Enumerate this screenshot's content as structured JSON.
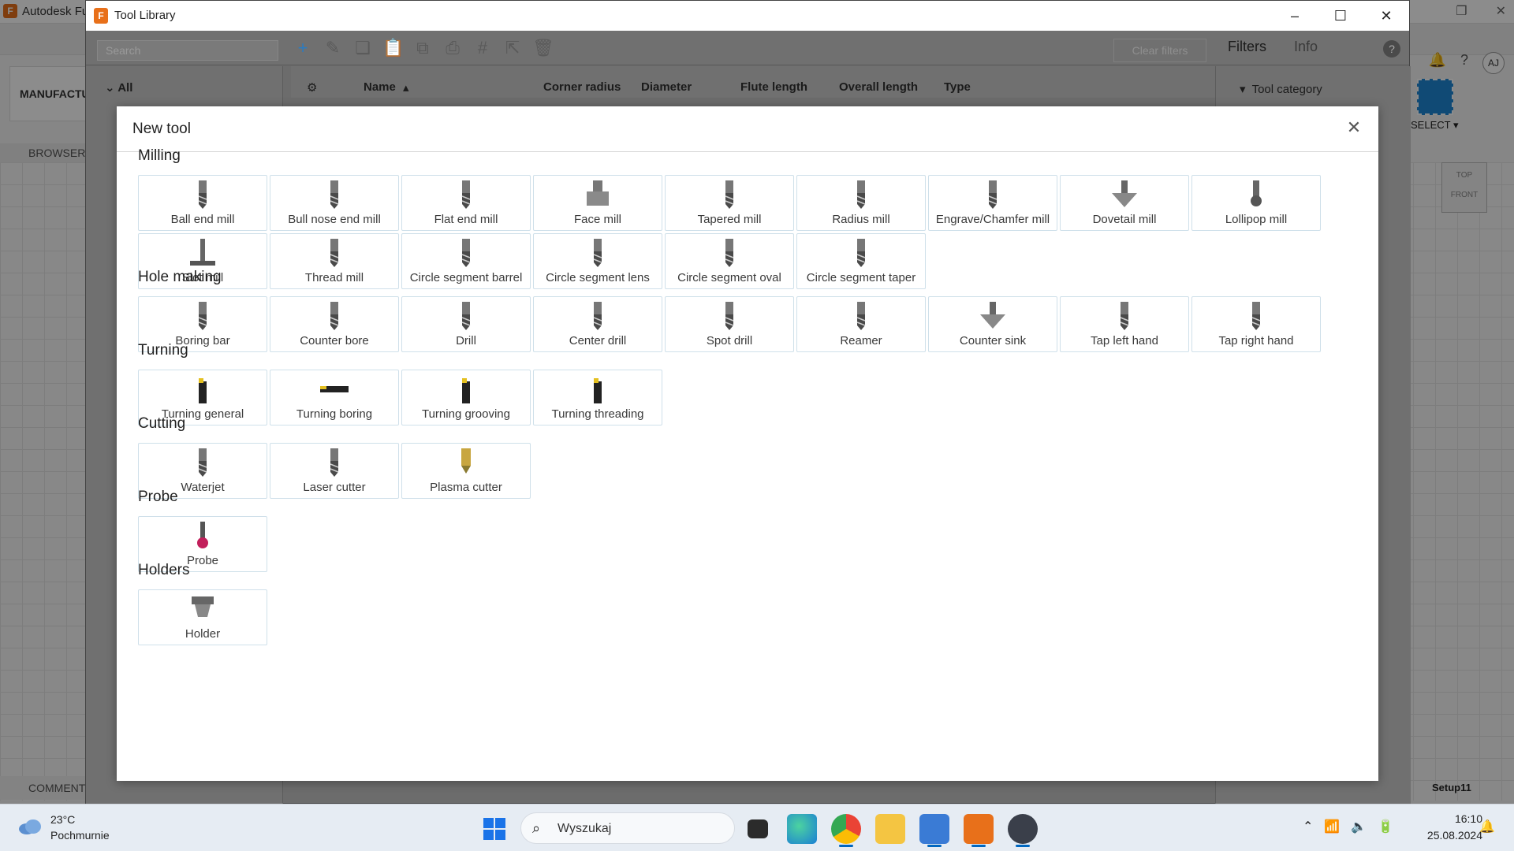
{
  "background_app": {
    "title": "Autodesk Fu",
    "manufacture": "MANUFACTU",
    "browser": "BROWSER",
    "comments": "COMMENT",
    "select_label": "SELECT ▾",
    "setup": "Setup11",
    "avatar": "AJ",
    "viewcube_top": "TOP",
    "viewcube_front": "FRONT"
  },
  "tool_library": {
    "title": "Tool Library",
    "search_placeholder": "Search",
    "clear_filters": "Clear filters",
    "tabs": {
      "filters": "Filters",
      "info": "Info"
    },
    "tree_all": "All",
    "columns": [
      "Name",
      "Corner radius",
      "Diameter",
      "Flute length",
      "Overall length",
      "Type"
    ],
    "tool_category": "Tool category"
  },
  "dialog": {
    "title": "New tool",
    "sections": [
      {
        "title": "Milling",
        "tools": [
          {
            "label": "Ball end mill",
            "icon": "ball-end-mill-icon"
          },
          {
            "label": "Bull nose end mill",
            "icon": "bull-nose-end-mill-icon"
          },
          {
            "label": "Flat end mill",
            "icon": "flat-end-mill-icon"
          },
          {
            "label": "Face mill",
            "icon": "face-mill-icon"
          },
          {
            "label": "Tapered mill",
            "icon": "tapered-mill-icon"
          },
          {
            "label": "Radius mill",
            "icon": "radius-mill-icon"
          },
          {
            "label": "Engrave/Chamfer mill",
            "icon": "engrave-chamfer-mill-icon"
          },
          {
            "label": "Dovetail mill",
            "icon": "dovetail-mill-icon"
          },
          {
            "label": "Lollipop mill",
            "icon": "lollipop-mill-icon"
          },
          {
            "label": "Slot mill",
            "icon": "slot-mill-icon"
          },
          {
            "label": "Thread mill",
            "icon": "thread-mill-icon"
          },
          {
            "label": "Circle segment barrel",
            "icon": "circle-segment-barrel-icon"
          },
          {
            "label": "Circle segment lens",
            "icon": "circle-segment-lens-icon"
          },
          {
            "label": "Circle segment oval",
            "icon": "circle-segment-oval-icon"
          },
          {
            "label": "Circle segment taper",
            "icon": "circle-segment-taper-icon"
          }
        ]
      },
      {
        "title": "Hole making",
        "tools": [
          {
            "label": "Boring bar",
            "icon": "boring-bar-icon"
          },
          {
            "label": "Counter bore",
            "icon": "counter-bore-icon"
          },
          {
            "label": "Drill",
            "icon": "drill-icon"
          },
          {
            "label": "Center drill",
            "icon": "center-drill-icon"
          },
          {
            "label": "Spot drill",
            "icon": "spot-drill-icon"
          },
          {
            "label": "Reamer",
            "icon": "reamer-icon"
          },
          {
            "label": "Counter sink",
            "icon": "counter-sink-icon"
          },
          {
            "label": "Tap left hand",
            "icon": "tap-left-hand-icon"
          },
          {
            "label": "Tap right hand",
            "icon": "tap-right-hand-icon"
          }
        ]
      },
      {
        "title": "Turning",
        "tools": [
          {
            "label": "Turning general",
            "icon": "turning-general-icon"
          },
          {
            "label": "Turning boring",
            "icon": "turning-boring-icon"
          },
          {
            "label": "Turning grooving",
            "icon": "turning-grooving-icon"
          },
          {
            "label": "Turning threading",
            "icon": "turning-threading-icon"
          }
        ]
      },
      {
        "title": "Cutting",
        "tools": [
          {
            "label": "Waterjet",
            "icon": "waterjet-icon"
          },
          {
            "label": "Laser cutter",
            "icon": "laser-cutter-icon"
          },
          {
            "label": "Plasma cutter",
            "icon": "plasma-cutter-icon"
          }
        ]
      },
      {
        "title": "Probe",
        "tools": [
          {
            "label": "Probe",
            "icon": "probe-icon"
          }
        ]
      },
      {
        "title": "Holders",
        "tools": [
          {
            "label": "Holder",
            "icon": "holder-icon"
          }
        ]
      }
    ]
  },
  "taskbar": {
    "weather_temp": "23°C",
    "weather_desc": "Pochmurnie",
    "search_label": "Wyszukaj",
    "time": "16:10",
    "date": "25.08.2024"
  }
}
